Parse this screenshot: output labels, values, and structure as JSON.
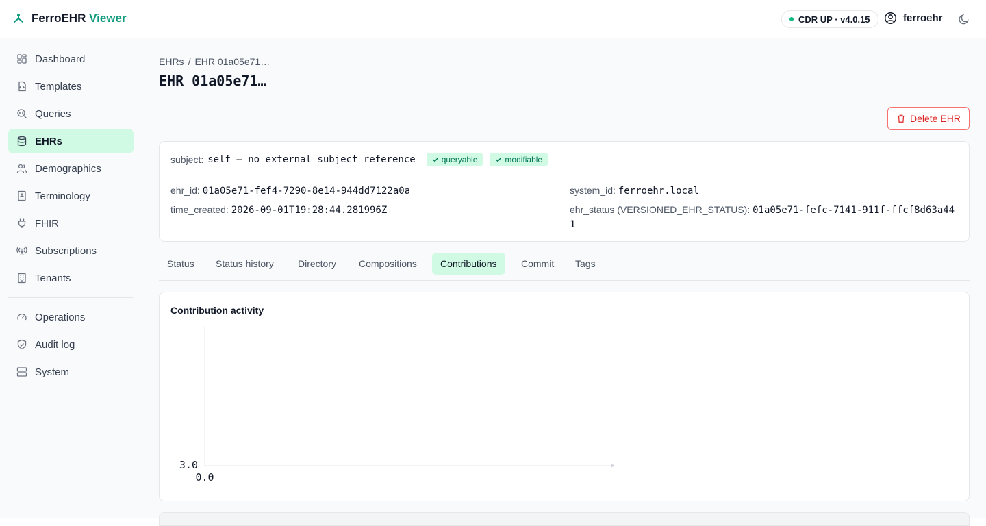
{
  "header": {
    "brand_name": "FerroEHR",
    "brand_suffix": "Viewer",
    "status": "CDR UP · v4.0.15",
    "username": "ferroehr"
  },
  "sidebar": {
    "items": [
      {
        "label": "Dashboard",
        "icon": "dashboard-icon"
      },
      {
        "label": "Templates",
        "icon": "template-icon"
      },
      {
        "label": "Queries",
        "icon": "query-icon"
      },
      {
        "label": "EHRs",
        "icon": "database-icon",
        "active": true
      },
      {
        "label": "Demographics",
        "icon": "users-icon"
      },
      {
        "label": "Terminology",
        "icon": "book-icon"
      },
      {
        "label": "FHIR",
        "icon": "plug-icon"
      },
      {
        "label": "Subscriptions",
        "icon": "broadcast-icon"
      },
      {
        "label": "Tenants",
        "icon": "building-icon"
      }
    ],
    "secondary_items": [
      {
        "label": "Operations",
        "icon": "gauge-icon"
      },
      {
        "label": "Audit log",
        "icon": "shield-icon"
      },
      {
        "label": "System",
        "icon": "server-icon"
      }
    ]
  },
  "breadcrumb": {
    "root": "EHRs",
    "separator": "/",
    "current": "EHR 01a05e71…"
  },
  "page": {
    "title": "EHR 01a05e71…",
    "delete_label": "Delete EHR"
  },
  "info": {
    "subject_label": "subject:",
    "subject_value": "self — no external subject reference",
    "badge_queryable": "queryable",
    "badge_modifiable": "modifiable",
    "ehr_id_label": "ehr_id:",
    "ehr_id_value": "01a05e71-fef4-7290-8e14-944dd7122a0a",
    "system_id_label": "system_id:",
    "system_id_value": "ferroehr.local",
    "time_created_label": "time_created:",
    "time_created_value": "2026-09-01T19:28:44.281996Z",
    "ehr_status_label": "ehr_status (VERSIONED_EHR_STATUS):",
    "ehr_status_value": "01a05e71-fefc-7141-911f-ffcf8d63a441"
  },
  "tabs": [
    "Status",
    "Status history",
    "Directory",
    "Compositions",
    "Contributions",
    "Commit",
    "Tags"
  ],
  "active_tab": "Contributions",
  "chart_data": {
    "type": "bar",
    "title": "Contribution activity",
    "categories": [],
    "values": [],
    "y_tick_labels": [
      "3.0"
    ],
    "x_tick_labels": [
      "0.0"
    ]
  },
  "colors": {
    "accent": "#0f9b7d",
    "active_bg": "#d1fae5",
    "danger": "#dc2626"
  }
}
